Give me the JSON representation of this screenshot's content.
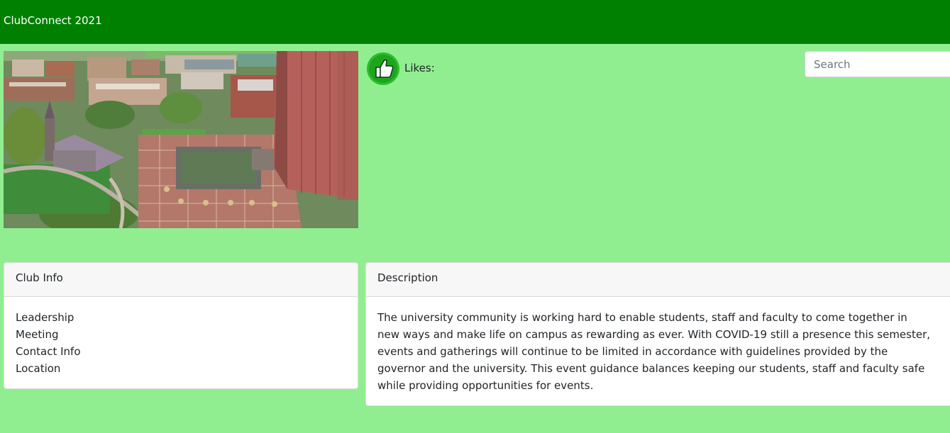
{
  "navbar": {
    "brand": "ClubConnect 2021",
    "color": "#008000"
  },
  "page": {
    "background": "#90ee90"
  },
  "hero": {
    "image": "campus-aerial-photo"
  },
  "likes": {
    "icon": "thumbs-up-icon",
    "label": "Likes:"
  },
  "search": {
    "placeholder": "Search",
    "value": ""
  },
  "club_info": {
    "header": "Club Info",
    "items": [
      "Leadership",
      "Meeting",
      "Contact Info",
      "Location"
    ]
  },
  "description": {
    "header": "Description",
    "text": "The university community is working hard to enable students, staff and faculty to come together in new ways and make life on campus as rewarding as ever. With COVID-19 still a presence this semester, events and gatherings will continue to be limited in accordance with guidelines provided by the governor and the university. This event guidance balances keeping our students, staff and faculty safe while providing opportunities for events."
  }
}
